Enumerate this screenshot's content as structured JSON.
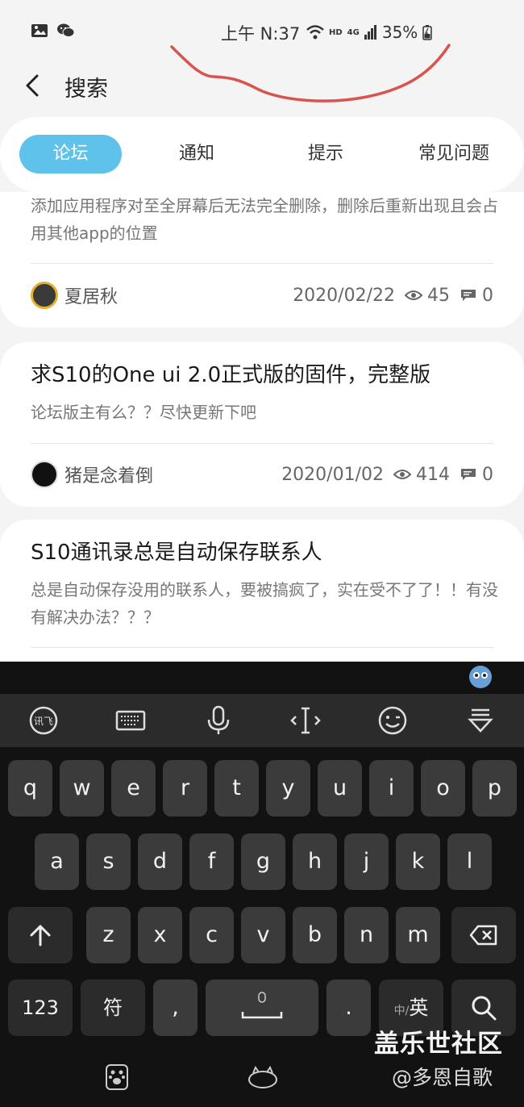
{
  "status_bar": {
    "time": "上午 N:37",
    "hd": "HD",
    "network": "4G",
    "battery": "35%"
  },
  "header": {
    "title": "搜索"
  },
  "tabs": [
    {
      "label": "论坛",
      "active": true
    },
    {
      "label": "通知",
      "active": false
    },
    {
      "label": "提示",
      "active": false
    },
    {
      "label": "常见问题",
      "active": false
    }
  ],
  "posts": [
    {
      "title": "",
      "body": "添加应用程序对至全屏幕后无法完全删除，删除后重新出现且会占用其他app的位置",
      "author": "夏居秋",
      "date": "2020/02/22",
      "views": "45",
      "replies": "0"
    },
    {
      "title": "求S10的One ui 2.0正式版的固件，完整版",
      "body": "论坛版主有么？？尽快更新下吧",
      "author": "猪是念着倒",
      "date": "2020/01/02",
      "views": "414",
      "replies": "0"
    },
    {
      "title": "S10通讯录总是自动保存联系人",
      "body": "总是自动保存没用的联系人，要被搞疯了，实在受不了了！！有没有解决办法？？？",
      "author": "",
      "date": "",
      "views": "",
      "replies": ""
    }
  ],
  "keyboard": {
    "row1": [
      "q",
      "w",
      "e",
      "r",
      "t",
      "y",
      "u",
      "i",
      "o",
      "p"
    ],
    "row2": [
      "a",
      "s",
      "d",
      "f",
      "g",
      "h",
      "j",
      "k",
      "l"
    ],
    "row3": [
      "z",
      "x",
      "c",
      "v",
      "b",
      "n",
      "m"
    ],
    "key_123": "123",
    "key_symbols": "符",
    "key_comma": ",",
    "key_period": ".",
    "key_lang_small": "中/",
    "key_lang_big": "英"
  },
  "watermark": {
    "site": "盖乐世社区",
    "user": "@多恩自歌"
  },
  "colors": {
    "accent": "#5ec2ea",
    "scribble": "#d9534f"
  },
  "icons": {
    "gallery": "gallery-icon",
    "wechat": "wechat-icon",
    "back": "back-arrow-icon",
    "eye": "eye-icon",
    "comment": "comment-icon",
    "voice": "iflytek-voice-icon",
    "keyboard": "keyboard-icon",
    "mic": "microphone-icon",
    "cursor": "cursor-icon",
    "emoji": "emoji-icon",
    "hide": "hide-keyboard-icon"
  }
}
